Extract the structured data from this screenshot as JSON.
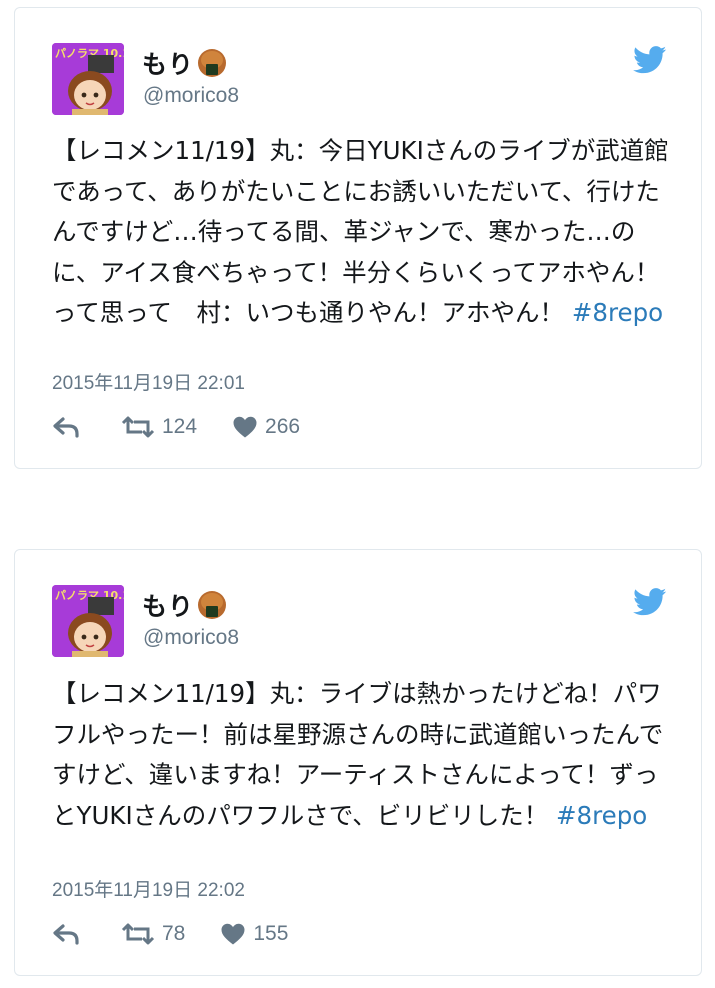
{
  "tweets": [
    {
      "name": "もり",
      "handle": "@morico8",
      "avatar_badge": "パノラマ 10.12",
      "text": "【レコメン11/19】丸：今日YUKIさんのライブが武道館であって、ありがたいことにお誘いいただいて、行けたんですけど…待ってる間、革ジャンで、寒かった…のに、アイス食べちゃって！半分くらいくってアホやん！って思って　村：いつも通りやん！アホやん！ ",
      "hashtag": "#8repo",
      "date": "2015年11月19日 22:01",
      "retweets": "124",
      "likes": "266"
    },
    {
      "name": "もり",
      "handle": "@morico8",
      "avatar_badge": "パノラマ 10.12",
      "text": "【レコメン11/19】丸：ライブは熱かったけどね！パワフルやったー！前は星野源さんの時に武道館いったんですけど、違いますね！アーティストさんによって！ずっとYUKIさんのパワフルさで、ビリビリした！ ",
      "hashtag": "#8repo",
      "date": "2015年11月19日 22:02",
      "retweets": "78",
      "likes": "155"
    }
  ],
  "icons": {
    "bird": "twitter-bird-icon",
    "reply": "reply-icon",
    "retweet": "retweet-icon",
    "like": "heart-icon",
    "emoji": "onigiri-emoji-icon"
  },
  "colors": {
    "twitter_blue": "#55acee",
    "hashtag": "#2b7bb9",
    "meta_gray": "#657786",
    "avatar_bg": "#a73bd8"
  }
}
